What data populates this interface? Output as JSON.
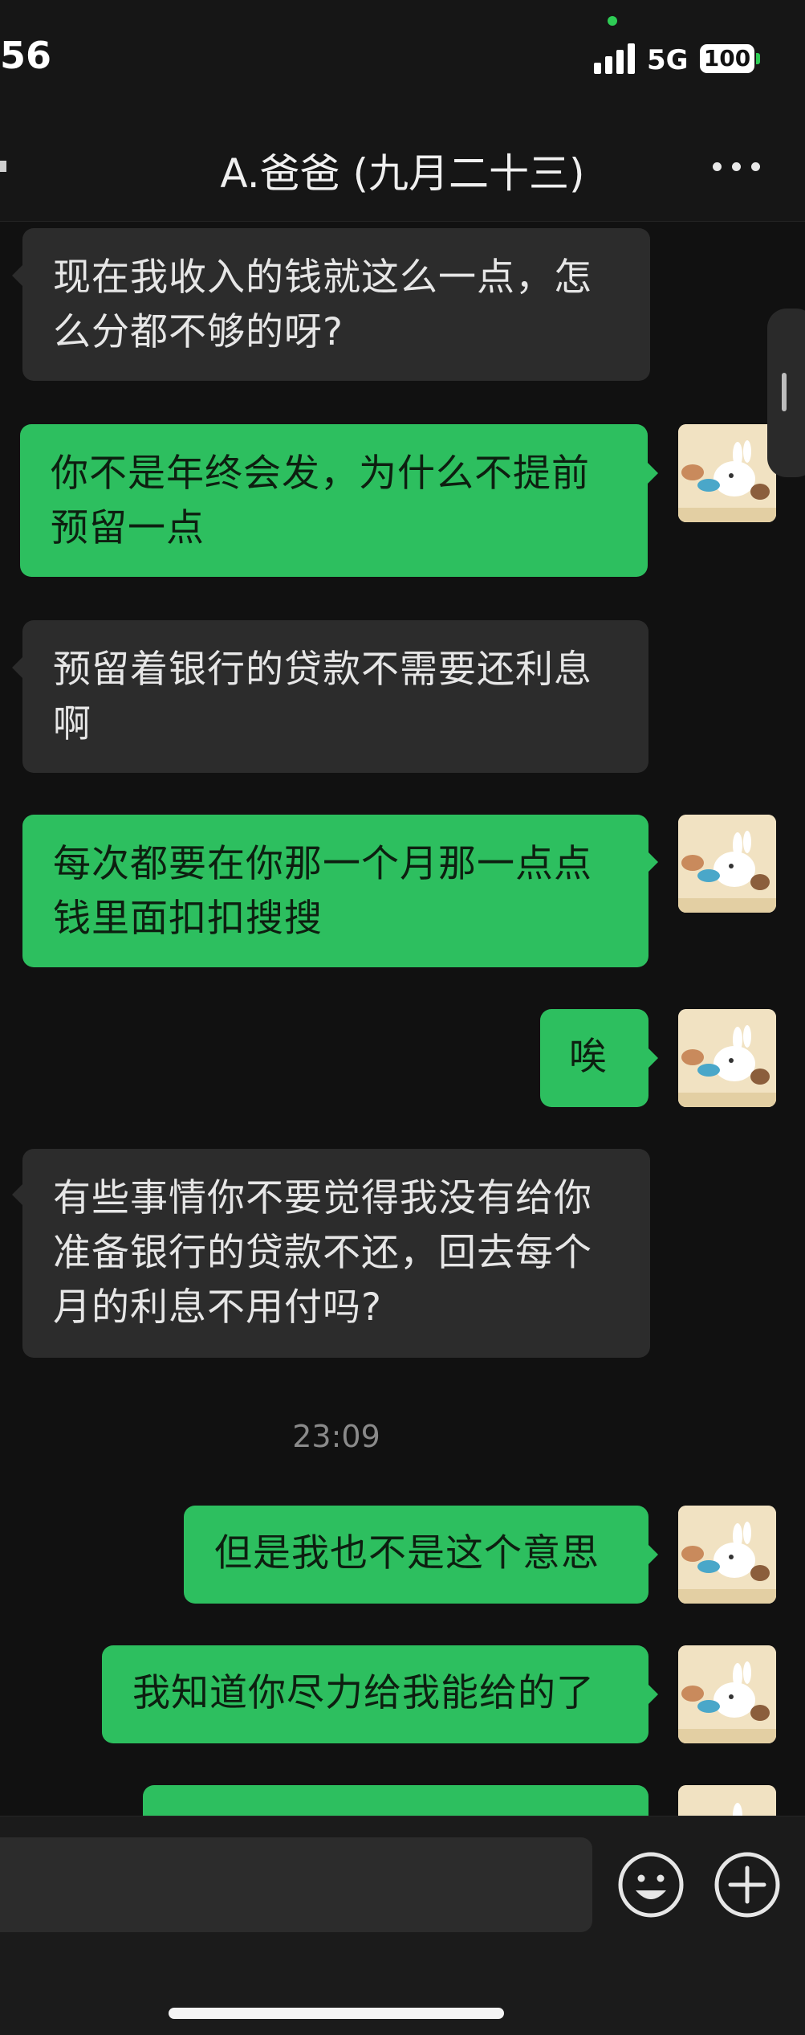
{
  "status_bar": {
    "time": "56",
    "network": "5G",
    "battery": "100"
  },
  "header": {
    "title": "A.爸爸 (九月二十三)"
  },
  "messages": [
    {
      "side": "in",
      "lines": [
        "现在我收入的钱就这么一点，怎",
        "么分都不够的呀?"
      ]
    },
    {
      "side": "out",
      "lines": [
        "你不是年终会发，为什么不提前",
        "预留一点"
      ]
    },
    {
      "side": "in",
      "lines": [
        "预留着银行的贷款不需要还利息",
        "啊"
      ]
    },
    {
      "side": "out",
      "lines": [
        "每次都要在你那一个月那一点点",
        "钱里面扣扣搜搜"
      ]
    },
    {
      "side": "out",
      "lines": [
        "唉"
      ]
    },
    {
      "side": "in",
      "lines": [
        "有些事情你不要觉得我没有给你",
        "准备银行的贷款不还，回去每个",
        "月的利息不用付吗?"
      ]
    },
    {
      "side": "out",
      "lines": [
        "但是我也不是这个意思"
      ]
    },
    {
      "side": "out",
      "lines": [
        "我知道你尽力给我能给的了"
      ]
    }
  ],
  "timestamp": "23:09",
  "colors": {
    "outgoing_bubble": "#2dbf5f",
    "incoming_bubble": "#2c2c2c",
    "background": "#111111"
  },
  "icons": {
    "more": "more-horizontal-icon",
    "emoji": "smiley-face-icon",
    "plus": "plus-circle-icon"
  }
}
